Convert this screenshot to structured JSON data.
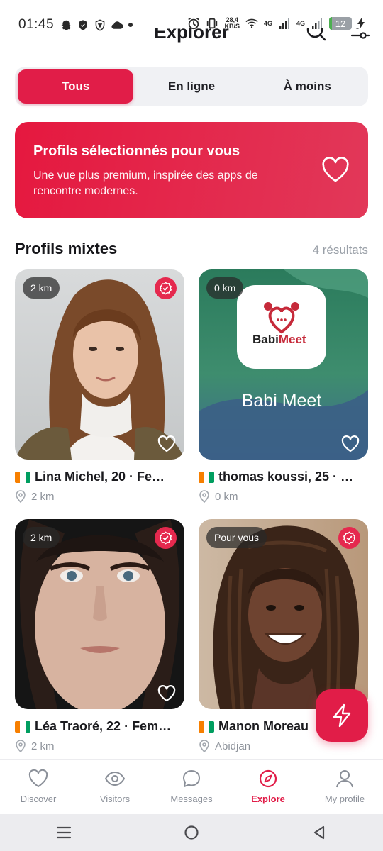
{
  "status_bar": {
    "time": "01:45",
    "net_speed_value": "28,4",
    "net_speed_unit": "KB/S",
    "signal_1": "4G",
    "signal_2": "4G",
    "battery": "12",
    "battery_level_percent": 12,
    "icons": [
      "snapchat-icon",
      "shield-icon",
      "vpn-shield-icon",
      "cloud-icon",
      "dot-icon",
      "alarm-icon",
      "vibrate-icon",
      "wifi-icon",
      "signal-icon",
      "battery-icon",
      "charging-icon"
    ]
  },
  "header": {
    "title": "Explorer",
    "icons": [
      "search-icon",
      "filter-icon"
    ]
  },
  "tabs": [
    {
      "label": "Tous",
      "active": true
    },
    {
      "label": "En ligne",
      "active": false
    },
    {
      "label": "À moins",
      "active": false
    }
  ],
  "promo": {
    "title": "Profils sélectionnés pour vous",
    "subtitle": "Une vue plus premium, inspirée des apps de rencontre modernes.",
    "icon": "heart-icon"
  },
  "section": {
    "title": "Profils mixtes",
    "count": "4 résultats"
  },
  "profiles": [
    {
      "badge": "2 km",
      "verified": true,
      "name": "Lina Michel, 20 · Fe…",
      "location": "2 km"
    },
    {
      "badge": "0 km",
      "verified": false,
      "name": "thomas koussi, 25 · …",
      "location": "0 km",
      "brand_name": "BabiMeet",
      "brand_name_babi": "Babi",
      "brand_name_meet": "Meet",
      "photo_caption": "Babi Meet"
    },
    {
      "badge": "2 km",
      "verified": true,
      "name": "Léa Traoré, 22 · Fem…",
      "location": "2 km"
    },
    {
      "badge": "Pour vous",
      "verified": true,
      "name": "Manon Moreau",
      "location": "Abidjan"
    }
  ],
  "fab": {
    "icon": "lightning-icon"
  },
  "bottom_nav": [
    {
      "label": "Discover",
      "icon": "heart-icon",
      "active": false
    },
    {
      "label": "Visitors",
      "icon": "eye-icon",
      "active": false
    },
    {
      "label": "Messages",
      "icon": "chat-bubble-icon",
      "active": false
    },
    {
      "label": "Explore",
      "icon": "compass-icon",
      "active": true
    },
    {
      "label": "My profile",
      "icon": "user-icon",
      "active": false
    }
  ],
  "system_nav": [
    "menu-icon",
    "home-icon",
    "back-icon"
  ],
  "colors": {
    "accent": "#e11d48",
    "muted": "#8a8f98",
    "flag_orange": "#f77f00",
    "flag_green": "#009e60"
  }
}
